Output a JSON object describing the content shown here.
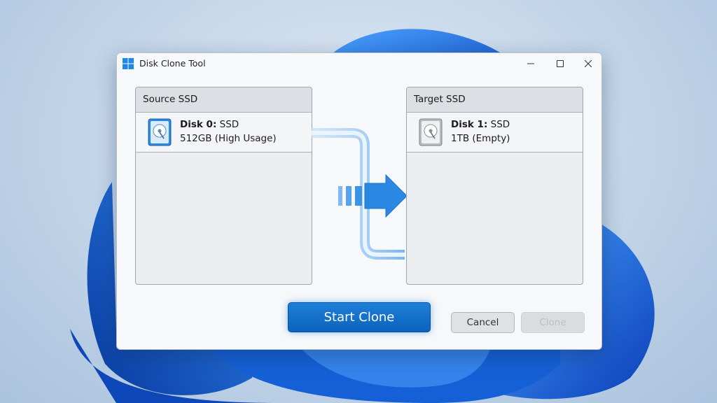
{
  "window": {
    "title": "Disk Clone Tool"
  },
  "source": {
    "header": "Source SSD",
    "disk_label": "Disk 0:",
    "disk_type": "SSD",
    "disk_info": "512GB (High Usage)"
  },
  "target": {
    "header": "Target SSD",
    "disk_label": "Disk 1:",
    "disk_type": "SSD",
    "disk_info": "1TB (Empty)"
  },
  "buttons": {
    "start": "Start Clone",
    "cancel": "Cancel",
    "clone": "Clone"
  },
  "colors": {
    "accent": "#0b63bd",
    "arrow": "#3b93e6"
  }
}
